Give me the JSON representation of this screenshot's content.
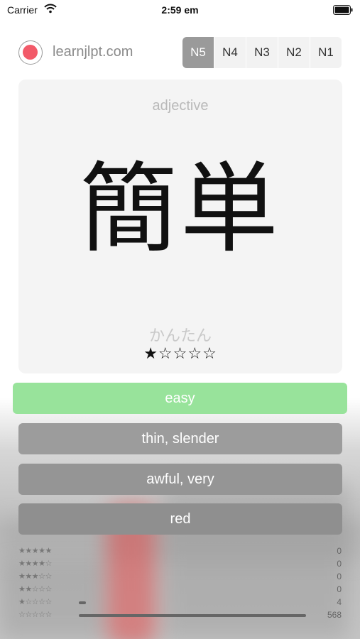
{
  "status_bar": {
    "carrier": "Carrier",
    "time": "2:59 em"
  },
  "header": {
    "site": "learnjlpt.com",
    "levels": [
      "N5",
      "N4",
      "N3",
      "N2",
      "N1"
    ],
    "active_level": "N5"
  },
  "card": {
    "part_of_speech": "adjective",
    "kanji": "簡単",
    "reading": "かんたん",
    "stars": "★☆☆☆☆",
    "star_rating": 1
  },
  "answers": [
    {
      "label": "easy",
      "state": "correct"
    },
    {
      "label": "thin, slender",
      "state": "neutral"
    },
    {
      "label": "awful, very",
      "state": "neutral"
    },
    {
      "label": "red",
      "state": "neutral"
    }
  ],
  "stats": {
    "total": 568,
    "rows": [
      {
        "stars": "★★★★★",
        "count": "0",
        "value": 0
      },
      {
        "stars": "★★★★☆",
        "count": "0",
        "value": 0
      },
      {
        "stars": "★★★☆☆",
        "count": "0",
        "value": 0
      },
      {
        "stars": "★★☆☆☆",
        "count": "0",
        "value": 0
      },
      {
        "stars": "★☆☆☆☆",
        "count": "4",
        "value": 4
      },
      {
        "stars": "☆☆☆☆☆",
        "count": "568",
        "value": 568
      }
    ]
  },
  "colors": {
    "accent_record": "#f25a69",
    "correct_answer": "#98e39b",
    "active_level": "#9a9a9a"
  }
}
